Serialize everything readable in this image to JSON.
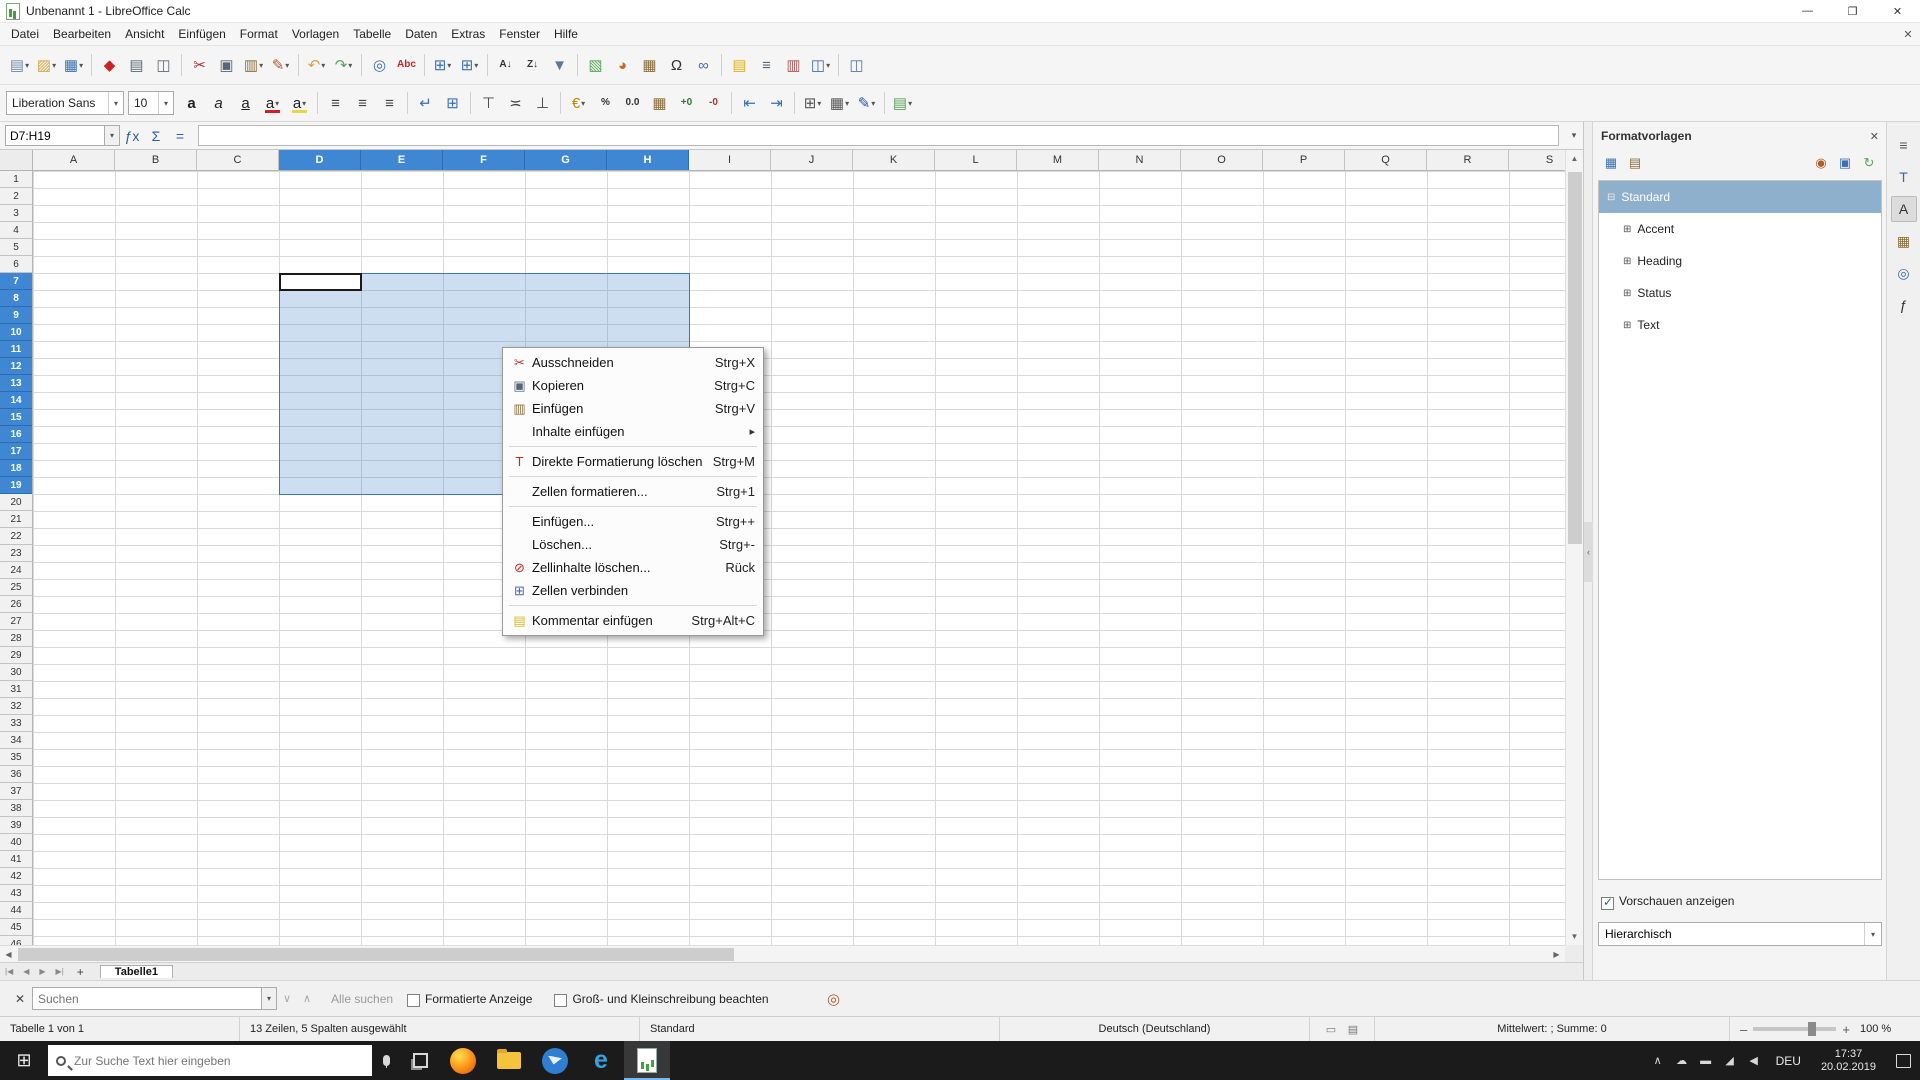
{
  "window": {
    "title": "Unbenannt 1 - LibreOffice Calc",
    "minimize_glyph": "—",
    "maximize_glyph": "❐",
    "close_glyph": "✕"
  },
  "menubar": {
    "items": [
      "Datei",
      "Bearbeiten",
      "Ansicht",
      "Einfügen",
      "Format",
      "Vorlagen",
      "Tabelle",
      "Daten",
      "Extras",
      "Fenster",
      "Hilfe"
    ],
    "close_document_glyph": "✕"
  },
  "toolbar_standard": {
    "items": [
      {
        "name": "new-button",
        "glyph": "▤",
        "color": "#6b8cae",
        "dd": true
      },
      {
        "name": "open-button",
        "glyph": "▨",
        "color": "#d9a441",
        "dd": true
      },
      {
        "name": "save-button",
        "glyph": "▦",
        "color": "#3a6fb0",
        "dd": true
      },
      {
        "sep": true
      },
      {
        "name": "export-pdf-button",
        "glyph": "◆",
        "color": "#cc2222"
      },
      {
        "name": "print-button",
        "glyph": "▤",
        "color": "#5a6b7a"
      },
      {
        "name": "print-preview-button",
        "glyph": "◫",
        "color": "#5a6b7a"
      },
      {
        "sep": true
      },
      {
        "name": "cut-button",
        "glyph": "✂",
        "color": "#aa3333"
      },
      {
        "name": "copy-button",
        "glyph": "▣",
        "color": "#556677"
      },
      {
        "name": "paste-button",
        "glyph": "▥",
        "color": "#8a6d3b",
        "dd": true
      },
      {
        "name": "clone-formatting-button",
        "glyph": "✎",
        "color": "#b05c2a",
        "dd": true
      },
      {
        "sep": true
      },
      {
        "name": "undo-button",
        "glyph": "↶",
        "color": "#d9a441",
        "dd": true
      },
      {
        "name": "redo-button",
        "glyph": "↷",
        "color": "#56a556",
        "dd": true
      },
      {
        "sep": true
      },
      {
        "name": "find-replace-button",
        "glyph": "◎",
        "color": "#3a6fb0"
      },
      {
        "name": "spelling-button",
        "glyph": "Abc",
        "color": "#cc2222",
        "text": true
      },
      {
        "sep": true
      },
      {
        "name": "insert-rows-button",
        "glyph": "⊞",
        "color": "#3a6fb0",
        "dd": true
      },
      {
        "name": "insert-columns-button",
        "glyph": "⊞",
        "color": "#3a6fb0",
        "dd": true
      },
      {
        "sep": true
      },
      {
        "name": "sort-ascending-button",
        "glyph": "A↓",
        "color": "#333333",
        "text": true
      },
      {
        "name": "sort-descending-button",
        "glyph": "Z↓",
        "color": "#333333",
        "text": true
      },
      {
        "name": "autofilter-button",
        "glyph": "▼",
        "color": "#5577aa"
      },
      {
        "sep": true
      },
      {
        "name": "insert-image-button",
        "glyph": "▧",
        "color": "#56a556"
      },
      {
        "name": "insert-chart-button",
        "glyph": "◕",
        "color": "#cc6622"
      },
      {
        "name": "insert-pivot-table-button",
        "glyph": "▦",
        "color": "#8a6d3b"
      },
      {
        "name": "special-character-button",
        "glyph": "Ω",
        "color": "#333333"
      },
      {
        "name": "hyperlink-button",
        "glyph": "∞",
        "color": "#3a6fb0"
      },
      {
        "sep": true
      },
      {
        "name": "insert-comment-button",
        "glyph": "▤",
        "color": "#e0b020"
      },
      {
        "name": "headers-footers-button",
        "glyph": "≡",
        "color": "#5a6b7a"
      },
      {
        "name": "print-area-button",
        "glyph": "▥",
        "color": "#aa5555"
      },
      {
        "name": "freeze-panes-button",
        "glyph": "◫",
        "color": "#3a6fb0",
        "dd": true
      },
      {
        "sep": true
      },
      {
        "name": "split-window-button",
        "glyph": "◫",
        "color": "#5577aa"
      }
    ]
  },
  "toolbar_formatting": {
    "font_name": "Liberation Sans",
    "font_size": "10",
    "items": [
      {
        "name": "bold-button",
        "glyph": "a",
        "color": "#222",
        "style": "font-weight:bold"
      },
      {
        "name": "italic-button",
        "glyph": "a",
        "color": "#222",
        "style": "font-style:italic"
      },
      {
        "name": "underline-button",
        "glyph": "a",
        "color": "#222",
        "style": "text-decoration:underline"
      },
      {
        "name": "font-color-button",
        "glyph": "a",
        "color": "#222",
        "bar": "#cc2222",
        "dd": true
      },
      {
        "name": "highlighting-color-button",
        "glyph": "a",
        "color": "#222",
        "bar": "#e8d44d",
        "dd": true
      },
      {
        "sep": true
      },
      {
        "name": "align-left-button",
        "glyph": "≡",
        "color": "#444"
      },
      {
        "name": "align-center-button",
        "glyph": "≡",
        "color": "#444"
      },
      {
        "name": "align-right-button",
        "glyph": "≡",
        "color": "#444"
      },
      {
        "sep": true
      },
      {
        "name": "wrap-text-button",
        "glyph": "↵",
        "color": "#3a6fb0"
      },
      {
        "name": "merge-cells-button",
        "glyph": "⊞",
        "color": "#3a6fb0"
      },
      {
        "sep": true
      },
      {
        "name": "align-top-button",
        "glyph": "⊤",
        "color": "#444"
      },
      {
        "name": "center-vertically-button",
        "glyph": "≍",
        "color": "#444"
      },
      {
        "name": "align-bottom-button",
        "glyph": "⊥",
        "color": "#444"
      },
      {
        "sep": true
      },
      {
        "name": "format-currency-button",
        "glyph": "€",
        "color": "#b8860b",
        "dd": true
      },
      {
        "name": "format-percent-button",
        "glyph": "%",
        "color": "#333333",
        "text": true
      },
      {
        "name": "format-number-button",
        "glyph": "0.0",
        "color": "#333333",
        "text": true
      },
      {
        "name": "format-date-button",
        "glyph": "▦",
        "color": "#8a6d3b"
      },
      {
        "name": "add-decimal-button",
        "glyph": "+0",
        "color": "#2a7a2a",
        "text": true
      },
      {
        "name": "delete-decimal-button",
        "glyph": "-0",
        "color": "#aa3333",
        "text": true
      },
      {
        "sep": true
      },
      {
        "name": "decrease-indent-button",
        "glyph": "⇤",
        "color": "#3a6fb0"
      },
      {
        "name": "increase-indent-button",
        "glyph": "⇥",
        "color": "#3a6fb0"
      },
      {
        "sep": true
      },
      {
        "name": "borders-button",
        "glyph": "⊞",
        "color": "#555555",
        "dd": true
      },
      {
        "name": "border-style-button",
        "glyph": "▦",
        "color": "#555555",
        "dd": true
      },
      {
        "name": "border-color-button",
        "glyph": "✎",
        "color": "#2255aa",
        "dd": true
      },
      {
        "sep": true
      },
      {
        "name": "conditional-formatting-button",
        "glyph": "▤",
        "color": "#56a556",
        "dd": true
      }
    ]
  },
  "formula_bar": {
    "name_box": "D7:H19",
    "function_wizard_glyph": "ƒx",
    "sum_glyph": "Σ",
    "equals_glyph": "=",
    "input_value": "",
    "expand_glyph": "▾"
  },
  "grid": {
    "columns": [
      "A",
      "B",
      "C",
      "D",
      "E",
      "F",
      "G",
      "H",
      "I",
      "J",
      "K",
      "L",
      "M",
      "N",
      "O",
      "P",
      "Q",
      "R",
      "S"
    ],
    "selected_columns": [
      "D",
      "E",
      "F",
      "G",
      "H"
    ],
    "row_count": 46,
    "selected_rows": {
      "from": 7,
      "to": 19
    },
    "active_cell": "D7"
  },
  "context_menu": {
    "items": [
      {
        "name": "ausschneiden",
        "icon": "cut-icon",
        "glyph": "✂",
        "color": "#aa3333",
        "label": "Ausschneiden",
        "shortcut": "Strg+X"
      },
      {
        "name": "kopieren",
        "icon": "copy-icon",
        "glyph": "▣",
        "color": "#556677",
        "label": "Kopieren",
        "shortcut": "Strg+C"
      },
      {
        "name": "einfuegen",
        "icon": "paste-icon",
        "glyph": "▥",
        "color": "#8a6d3b",
        "label": "Einfügen",
        "shortcut": "Strg+V"
      },
      {
        "name": "inhalte-einfuegen",
        "label": "Inhalte einfügen",
        "submenu": true
      },
      {
        "type": "separator"
      },
      {
        "name": "direkte-formatierung-loeschen",
        "icon": "clear-formatting-icon",
        "glyph": "T",
        "color": "#b03030",
        "label": "Direkte Formatierung löschen",
        "shortcut": "Strg+M"
      },
      {
        "type": "separator"
      },
      {
        "name": "zellen-formatieren",
        "label": "Zellen formatieren...",
        "shortcut": "Strg+1"
      },
      {
        "type": "separator"
      },
      {
        "name": "zellen-einfuegen",
        "label": "Einfügen...",
        "shortcut": "Strg++"
      },
      {
        "name": "zellen-loeschen",
        "label": "Löschen...",
        "shortcut": "Strg+-"
      },
      {
        "name": "zellinhalte-loeschen",
        "icon": "delete-contents-icon",
        "glyph": "⊘",
        "color": "#cc2222",
        "label": "Zellinhalte löschen...",
        "shortcut": "Rück"
      },
      {
        "name": "zellen-verbinden",
        "icon": "merge-cells-icon",
        "glyph": "⊞",
        "color": "#3a6fb0",
        "label": "Zellen verbinden"
      },
      {
        "type": "separator"
      },
      {
        "name": "kommentar-einfuegen",
        "icon": "comment-icon",
        "glyph": "▤",
        "color": "#d9b820",
        "label": "Kommentar einfügen",
        "shortcut": "Strg+Alt+C"
      }
    ]
  },
  "sidebar": {
    "title": "Formatvorlagen",
    "close_glyph": "✕",
    "tools_left": [
      {
        "name": "cell-styles-icon",
        "glyph": "▦",
        "color": "#3a6fb0"
      },
      {
        "name": "page-styles-icon",
        "glyph": "▤",
        "color": "#8a6d3b"
      }
    ],
    "tools_right": [
      {
        "name": "fill-format-mode-icon",
        "glyph": "◉",
        "color": "#b05c2a"
      },
      {
        "name": "new-style-from-selection-icon",
        "glyph": "▣",
        "color": "#3a6fb0"
      },
      {
        "name": "update-style-icon",
        "glyph": "↻",
        "color": "#56a556"
      }
    ],
    "tree": [
      {
        "label": "Standard",
        "level": 0,
        "selected": true,
        "expanded": true
      },
      {
        "label": "Accent",
        "level": 1
      },
      {
        "label": "Heading",
        "level": 1
      },
      {
        "label": "Status",
        "level": 1
      },
      {
        "label": "Text",
        "level": 1
      }
    ],
    "previews_label": "Vorschauen anzeigen",
    "filter_value": "Hierarchisch",
    "tabs": [
      {
        "name": "sidebar-settings-icon",
        "glyph": "≡",
        "color": "#555"
      },
      {
        "name": "properties-tab",
        "glyph": "T",
        "color": "#2a6db5"
      },
      {
        "name": "styles-tab",
        "glyph": "A",
        "color": "#333",
        "active": true
      },
      {
        "name": "gallery-tab",
        "glyph": "▦",
        "color": "#8a6d3b"
      },
      {
        "name": "navigator-tab",
        "glyph": "◎",
        "color": "#3a6fb0"
      },
      {
        "name": "functions-tab",
        "glyph": "ƒ",
        "color": "#333"
      }
    ]
  },
  "sheet_tabs": {
    "nav": [
      {
        "name": "first-sheet-button",
        "glyph": "|◀"
      },
      {
        "name": "previous-sheet-button",
        "glyph": "◀"
      },
      {
        "name": "next-sheet-button",
        "glyph": "▶"
      },
      {
        "name": "last-sheet-button",
        "glyph": "▶|"
      }
    ],
    "add_glyph": "+",
    "tabs": [
      {
        "label": "Tabelle1",
        "active": true
      }
    ]
  },
  "find_bar": {
    "close_glyph": "✕",
    "search_placeholder": "Suchen",
    "prev_glyph": "∨",
    "next_glyph": "∧",
    "find_all": "Alle suchen",
    "formatted_label": "Formatierte Anzeige",
    "match_case_label": "Groß- und Kleinschreibung beachten",
    "dialog_icon_glyph": "◎"
  },
  "status_bar": {
    "sheet": "Tabelle 1 von 1",
    "selection": "13 Zeilen, 5 Spalten ausgewählt",
    "page_style": "Standard",
    "language": "Deutsch (Deutschland)",
    "selection_mode_glyph": "▭",
    "modified_glyph": "▤",
    "stats": "Mittelwert: ; Summe: 0",
    "zoom_minus": "–",
    "zoom_plus": "+",
    "zoom_level": "100 %"
  },
  "taskbar": {
    "search_placeholder": "Zur Suche Text hier eingeben",
    "apps": [
      {
        "name": "taskbar-app-firefox",
        "type": "firefox"
      },
      {
        "name": "taskbar-app-explorer",
        "type": "explorer"
      },
      {
        "name": "taskbar-app-thunderbird",
        "type": "thunderbird"
      },
      {
        "name": "taskbar-app-edge",
        "type": "edge",
        "glyph": "e"
      },
      {
        "name": "taskbar-app-libreoffice-calc",
        "type": "calc",
        "active": true
      }
    ],
    "tray": [
      {
        "name": "hidden-icons-chevron",
        "glyph": "∧"
      },
      {
        "name": "onedrive-icon",
        "glyph": "☁"
      },
      {
        "name": "battery-icon",
        "glyph": "▬"
      },
      {
        "name": "network-icon",
        "glyph": "◢"
      },
      {
        "name": "volume-icon",
        "glyph": "◀"
      }
    ],
    "language": "DEU",
    "time": "17:37",
    "date": "20.02.2019"
  }
}
